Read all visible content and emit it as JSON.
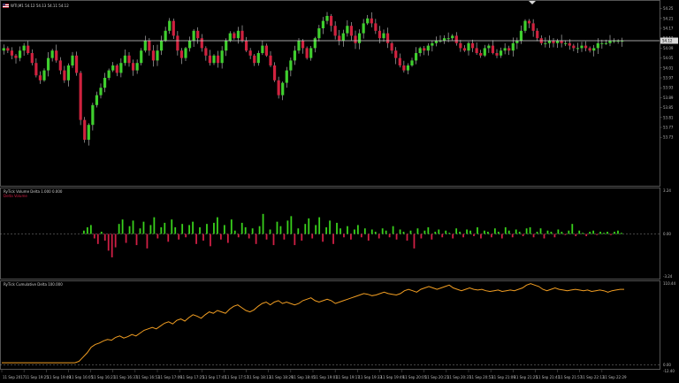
{
  "colors": {
    "background": "#000000",
    "bull_candle": "#3fcf2e",
    "bear_candle": "#d0223f",
    "wick": "#c8c8c8",
    "delta_positive": "#39d11c",
    "delta_negative": "#d01f45",
    "cumulative_line": "#f29e22",
    "price_line": "#d8d8d8",
    "grid": "#6a6a6a"
  },
  "header": {
    "symbol_flag_icon": "us-flag-icon",
    "price_header": "WTI,M1  54.12 54.13 54.11 54.12"
  },
  "delta_header": {
    "title": "RyTick Volume Delta 1.000 0.000",
    "subtitle": "Delta Volume"
  },
  "cumulative_header": {
    "title": "RyTick Cumulative Delta 100.000"
  },
  "top_marker_icon": "triangle-down-icon",
  "chart_data": [
    {
      "type": "candlestick",
      "ylim": [
        53.57,
        54.27
      ],
      "yticks": [
        "54.25",
        "54.21",
        "54.17",
        "54.13",
        "54.09",
        "54.05",
        "54.01",
        "53.97",
        "53.93",
        "53.89",
        "53.85",
        "53.81",
        "53.77",
        "53.73"
      ],
      "current_price": "54.12",
      "current_price_value": 54.12,
      "x_labels": [
        "11 Sep 2017",
        "11 Sep 19:25",
        "11 Sep 19:49",
        "11 Sep 16:05",
        "11 Sep 16:21",
        "11 Sep 16:37",
        "11 Sep 16:53",
        "11 Sep 17:09",
        "11 Sep 17:25",
        "11 Sep 17:41",
        "11 Sep 17:57",
        "11 Sep 18:13",
        "11 Sep 18:29",
        "11 Sep 18:45",
        "11 Sep 19:01",
        "11 Sep 19:17",
        "11 Sep 19:33",
        "11 Sep 19:49",
        "11 Sep 20:05",
        "11 Sep 20:21",
        "11 Sep 20:37",
        "11 Sep 20:53",
        "11 Sep 21:09",
        "11 Sep 21:25",
        "11 Sep 21:41",
        "11 Sep 21:57",
        "11 Sep 22:13",
        "11 Sep 22:29"
      ],
      "close_path": [
        54.09,
        54.08,
        54.06,
        54.05,
        54.08,
        54.1,
        54.07,
        54.03,
        53.98,
        53.96,
        54.0,
        54.05,
        54.08,
        54.04,
        54.0,
        53.96,
        54.02,
        54.06,
        53.99,
        53.8,
        53.72,
        53.78,
        53.86,
        53.9,
        53.93,
        53.97,
        54.0,
        54.02,
        53.99,
        54.03,
        54.06,
        54.03,
        54.0,
        54.03,
        54.08,
        54.12,
        54.08,
        54.04,
        54.08,
        54.12,
        54.16,
        54.2,
        54.14,
        54.08,
        54.05,
        54.09,
        54.12,
        54.16,
        54.13,
        54.09,
        54.06,
        54.03,
        54.06,
        54.03,
        54.08,
        54.12,
        54.15,
        54.13,
        54.16,
        54.12,
        54.08,
        54.06,
        54.03,
        54.07,
        54.1,
        54.06,
        54.02,
        53.96,
        53.9,
        53.95,
        54.0,
        54.04,
        54.08,
        54.12,
        54.09,
        54.05,
        54.09,
        54.13,
        54.17,
        54.2,
        54.22,
        54.18,
        54.14,
        54.12,
        54.15,
        54.18,
        54.14,
        54.11,
        54.15,
        54.19,
        54.21,
        54.19,
        54.16,
        54.13,
        54.15,
        54.11,
        54.08,
        54.05,
        54.02,
        54.0,
        54.02,
        54.04,
        54.07,
        54.09,
        54.08,
        54.1,
        54.11,
        54.12,
        54.12,
        54.13,
        54.13,
        54.14,
        54.11,
        54.09,
        54.08,
        54.11,
        54.09,
        54.07,
        54.06,
        54.09,
        54.1,
        54.07,
        54.06,
        54.08,
        54.09,
        54.08,
        54.11,
        54.12,
        54.16,
        54.2,
        54.19,
        54.16,
        54.13,
        54.11,
        54.11,
        54.12,
        54.11,
        54.12,
        54.11,
        54.11,
        54.1,
        54.09,
        54.09,
        54.1,
        54.09,
        54.08,
        54.09,
        54.11,
        54.11,
        54.11,
        54.12,
        54.12,
        54.12,
        54.12
      ]
    },
    {
      "type": "bar",
      "title": "RyTick Volume Delta 1.000 0.000",
      "ylim": [
        -3.24,
        3.24
      ],
      "yticks": [
        "3.24",
        "0.00",
        "-3.24"
      ],
      "values": [
        0.3,
        0.6,
        0.8,
        -0.4,
        -0.9,
        0.2,
        -0.6,
        -1.5,
        -2.1,
        -1.2,
        0.9,
        1.3,
        -0.8,
        0.7,
        1.2,
        -1.0,
        0.5,
        1.1,
        -1.3,
        0.8,
        1.5,
        -0.4,
        0.6,
        1.0,
        -0.7,
        1.3,
        0.6,
        -0.5,
        0.9,
        -0.3,
        0.8,
        1.1,
        -0.9,
        0.6,
        -0.6,
        0.9,
        -1.1,
        1.0,
        1.5,
        -0.5,
        0.8,
        -0.8,
        1.3,
        0.3,
        -0.3,
        1.0,
        0.6,
        -0.4,
        0.5,
        -0.9,
        0.7,
        1.8,
        -0.5,
        0.4,
        -1.0,
        1.1,
        0.7,
        -0.5,
        1.2,
        1.6,
        -1.0,
        0.5,
        -0.6,
        0.9,
        1.4,
        -0.4,
        0.8,
        1.5,
        -0.7,
        0.6,
        1.2,
        -0.9,
        1.0,
        0.5,
        -0.3,
        0.7,
        -0.5,
        0.4,
        0.8,
        -0.3,
        0.5,
        -0.6,
        0.4,
        0.2,
        -0.4,
        0.5,
        0.3,
        -0.3,
        0.7,
        -0.5,
        0.4,
        0.2,
        -0.6,
        0.3,
        -1.3,
        0.5,
        -0.4,
        0.3,
        0.6,
        -0.5,
        0.2,
        0.4,
        -0.3,
        0.3,
        0.1,
        -0.4,
        0.5,
        0.2,
        -0.3,
        0.4,
        0.3,
        -0.2,
        0.6,
        -0.4,
        0.3,
        0.2,
        -0.3,
        0.5,
        0.2,
        -0.4,
        0.6,
        0.3,
        -0.3,
        0.4,
        0.2,
        -0.2,
        0.5,
        0.6,
        -0.3,
        0.2,
        0.5,
        -0.4,
        0.3,
        0.2,
        -0.3,
        0.4,
        0.2,
        -0.1,
        0.3,
        0.9,
        -0.2,
        0.3,
        0.1,
        -0.2,
        0.2,
        0.3,
        -0.1,
        0.2,
        0.1,
        0.2,
        -0.1,
        0.2,
        0.3,
        0.1
      ]
    },
    {
      "type": "line",
      "title": "RyTick Cumulative Delta 100.000",
      "ylim": [
        -12.4,
        110.4
      ],
      "yticks": [
        "110.44",
        "0.00",
        "-12.40"
      ],
      "values": [
        0,
        0,
        0,
        0,
        0,
        0,
        0,
        0,
        0,
        0,
        0,
        0,
        0,
        0,
        0,
        0,
        0,
        0,
        0,
        2,
        8,
        14,
        22,
        26,
        28,
        31,
        33,
        32,
        36,
        38,
        35,
        37,
        40,
        38,
        42,
        46,
        48,
        50,
        48,
        52,
        56,
        58,
        55,
        60,
        62,
        59,
        64,
        68,
        66,
        63,
        68,
        72,
        70,
        74,
        72,
        70,
        76,
        80,
        82,
        78,
        74,
        72,
        75,
        80,
        84,
        86,
        82,
        86,
        88,
        84,
        86,
        84,
        82,
        84,
        88,
        90,
        92,
        88,
        86,
        88,
        90,
        88,
        84,
        86,
        88,
        90,
        92,
        94,
        96,
        98,
        97,
        95,
        96,
        98,
        100,
        98,
        97,
        96,
        98,
        102,
        104,
        102,
        100,
        104,
        106,
        108,
        106,
        104,
        106,
        108,
        110,
        106,
        104,
        102,
        104,
        106,
        104,
        103,
        104,
        102,
        101,
        102,
        103,
        101,
        102,
        103,
        102,
        104,
        106,
        110,
        112,
        110,
        108,
        104,
        102,
        104,
        106,
        104,
        103,
        102,
        103,
        104,
        103,
        102,
        103,
        101,
        102,
        103,
        102,
        100,
        102,
        103,
        104,
        104
      ]
    }
  ]
}
